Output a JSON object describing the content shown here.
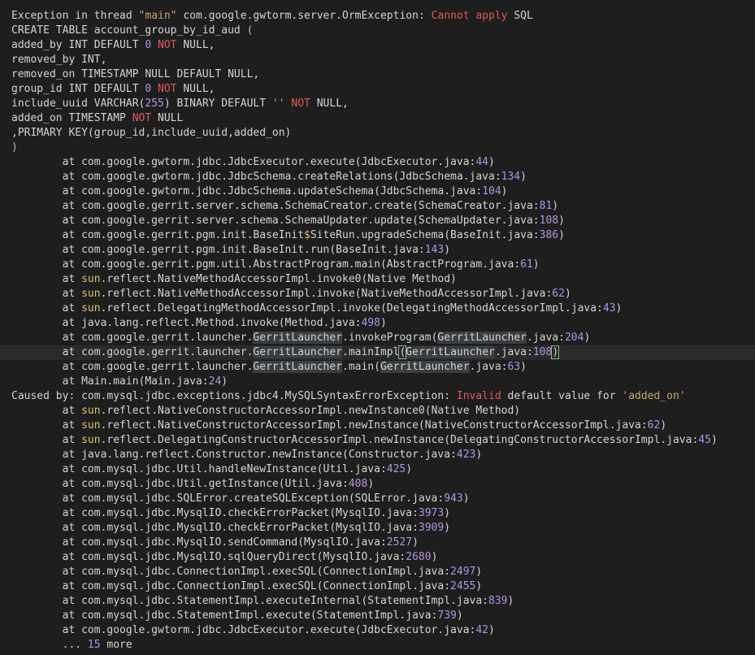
{
  "lines": [
    [
      {
        "t": "Exception in thread ",
        "c": ""
      },
      {
        "t": "\"main\"",
        "c": "str"
      },
      {
        "t": " com.google.gwtorm.server.OrmException",
        "c": ""
      },
      {
        "t": ": ",
        "c": ""
      },
      {
        "t": "Cannot apply",
        "c": "kw"
      },
      {
        "t": " SQL",
        "c": ""
      }
    ],
    [
      {
        "t": "CREATE TABLE account_group_by_id_aud ",
        "c": ""
      },
      {
        "t": "(",
        "c": "paren"
      }
    ],
    [
      {
        "t": "added_by INT DEFAULT ",
        "c": ""
      },
      {
        "t": "0",
        "c": "num"
      },
      {
        "t": " ",
        "c": ""
      },
      {
        "t": "NOT",
        "c": "kw"
      },
      {
        "t": " NULL,",
        "c": ""
      }
    ],
    [
      {
        "t": "removed_by INT,",
        "c": ""
      }
    ],
    [
      {
        "t": "removed_on TIMESTAMP NULL DEFAULT NULL,",
        "c": ""
      }
    ],
    [
      {
        "t": "group_id INT DEFAULT ",
        "c": ""
      },
      {
        "t": "0",
        "c": "num"
      },
      {
        "t": " ",
        "c": ""
      },
      {
        "t": "NOT",
        "c": "kw"
      },
      {
        "t": " NULL,",
        "c": ""
      }
    ],
    [
      {
        "t": "include_uuid VARCHAR(",
        "c": ""
      },
      {
        "t": "255",
        "c": "num"
      },
      {
        "t": ") BINARY DEFAULT ",
        "c": ""
      },
      {
        "t": "''",
        "c": "str"
      },
      {
        "t": " ",
        "c": ""
      },
      {
        "t": "NOT",
        "c": "kw"
      },
      {
        "t": " NULL,",
        "c": ""
      }
    ],
    [
      {
        "t": "added_on TIMESTAMP ",
        "c": ""
      },
      {
        "t": "NOT",
        "c": "kw"
      },
      {
        "t": " NULL",
        "c": ""
      }
    ],
    [
      {
        "t": ",PRIMARY KEY(group_id,include_uuid,added_on)",
        "c": ""
      }
    ],
    [
      {
        "t": ")",
        "c": "paren"
      }
    ],
    [
      {
        "t": "        at com.google.gwtorm.jdbc.JdbcExecutor.execute(JdbcExecutor.java:",
        "c": ""
      },
      {
        "t": "44",
        "c": "num"
      },
      {
        "t": ")",
        "c": ""
      }
    ],
    [
      {
        "t": "        at com.google.gwtorm.jdbc.JdbcSchema.createRelations(JdbcSchema.java:",
        "c": ""
      },
      {
        "t": "134",
        "c": "num"
      },
      {
        "t": ")",
        "c": ""
      }
    ],
    [
      {
        "t": "        at com.google.gwtorm.jdbc.JdbcSchema.updateSchema(JdbcSchema.java:",
        "c": ""
      },
      {
        "t": "104",
        "c": "num"
      },
      {
        "t": ")",
        "c": ""
      }
    ],
    [
      {
        "t": "        at com.google.gerrit.server.schema.SchemaCreator.create(SchemaCreator.java:",
        "c": ""
      },
      {
        "t": "81",
        "c": "num"
      },
      {
        "t": ")",
        "c": ""
      }
    ],
    [
      {
        "t": "        at com.google.gerrit.server.schema.SchemaUpdater.update(SchemaUpdater.java:",
        "c": ""
      },
      {
        "t": "108",
        "c": "num"
      },
      {
        "t": ")",
        "c": ""
      }
    ],
    [
      {
        "t": "        at com.google.gerrit.pgm.init.BaseInit",
        "c": ""
      },
      {
        "t": "$",
        "c": "pkg"
      },
      {
        "t": "SiteRun.upgradeSchema(BaseInit.java:",
        "c": ""
      },
      {
        "t": "386",
        "c": "num"
      },
      {
        "t": ")",
        "c": ""
      }
    ],
    [
      {
        "t": "        at com.google.gerrit.pgm.init.BaseInit.run(BaseInit.java:",
        "c": ""
      },
      {
        "t": "143",
        "c": "num"
      },
      {
        "t": ")",
        "c": ""
      }
    ],
    [
      {
        "t": "        at com.google.gerrit.pgm.util.AbstractProgram.main(AbstractProgram.java:",
        "c": ""
      },
      {
        "t": "61",
        "c": "num"
      },
      {
        "t": ")",
        "c": ""
      }
    ],
    [
      {
        "t": "        at ",
        "c": ""
      },
      {
        "t": "sun",
        "c": "pkg"
      },
      {
        "t": ".reflect.NativeMethodAccessorImpl.invoke0(Native Method)",
        "c": ""
      }
    ],
    [
      {
        "t": "        at ",
        "c": ""
      },
      {
        "t": "sun",
        "c": "pkg"
      },
      {
        "t": ".reflect.NativeMethodAccessorImpl.invoke(NativeMethodAccessorImpl.java:",
        "c": ""
      },
      {
        "t": "62",
        "c": "num"
      },
      {
        "t": ")",
        "c": ""
      }
    ],
    [
      {
        "t": "        at ",
        "c": ""
      },
      {
        "t": "sun",
        "c": "pkg"
      },
      {
        "t": ".reflect.DelegatingMethodAccessorImpl.invoke(DelegatingMethodAccessorImpl.java:",
        "c": ""
      },
      {
        "t": "43",
        "c": "num"
      },
      {
        "t": ")",
        "c": ""
      }
    ],
    [
      {
        "t": "        at java.lang.reflect.Method.invoke(Method.java:",
        "c": ""
      },
      {
        "t": "498",
        "c": "num"
      },
      {
        "t": ")",
        "c": ""
      }
    ],
    [
      {
        "t": "        at com.google.gerrit.launcher.",
        "c": ""
      },
      {
        "t": "GerritLauncher",
        "c": "hl"
      },
      {
        "t": ".invokeProgram(",
        "c": ""
      },
      {
        "t": "GerritLauncher",
        "c": "hl"
      },
      {
        "t": ".java:",
        "c": ""
      },
      {
        "t": "204",
        "c": "num"
      },
      {
        "t": ")",
        "c": ""
      }
    ],
    [
      {
        "t": "        at com.google.gerrit.launcher.",
        "c": ""
      },
      {
        "t": "GerritLauncher",
        "c": "hl"
      },
      {
        "t": ".mainImpl",
        "c": ""
      },
      {
        "t": "(",
        "c": "bracket"
      },
      {
        "t": "GerritLauncher",
        "c": "hl"
      },
      {
        "t": ".java:",
        "c": ""
      },
      {
        "t": "108",
        "c": "num"
      },
      {
        "t": ")",
        "c": "bracket"
      }
    ],
    [
      {
        "t": "        at com.google.gerrit.launcher.",
        "c": ""
      },
      {
        "t": "GerritLauncher",
        "c": "hl"
      },
      {
        "t": ".main(",
        "c": ""
      },
      {
        "t": "GerritLauncher",
        "c": "hl"
      },
      {
        "t": ".java:",
        "c": ""
      },
      {
        "t": "63",
        "c": "num"
      },
      {
        "t": ")",
        "c": ""
      }
    ],
    [
      {
        "t": "        at Main.main(Main.java:",
        "c": ""
      },
      {
        "t": "24",
        "c": "num"
      },
      {
        "t": ")",
        "c": ""
      }
    ],
    [
      {
        "t": "Caused by: com.mysql.jdbc.exceptions.jdbc4.MySQLSyntaxErrorException: ",
        "c": ""
      },
      {
        "t": "Invalid",
        "c": "kw"
      },
      {
        "t": " default value for ",
        "c": ""
      },
      {
        "t": "'added_on'",
        "c": "str"
      }
    ],
    [
      {
        "t": "        at ",
        "c": ""
      },
      {
        "t": "sun",
        "c": "pkg"
      },
      {
        "t": ".reflect.NativeConstructorAccessorImpl.newInstance0(Native Method)",
        "c": ""
      }
    ],
    [
      {
        "t": "        at ",
        "c": ""
      },
      {
        "t": "sun",
        "c": "pkg"
      },
      {
        "t": ".reflect.NativeConstructorAccessorImpl.newInstance(NativeConstructorAccessorImpl.java:",
        "c": ""
      },
      {
        "t": "62",
        "c": "num"
      },
      {
        "t": ")",
        "c": ""
      }
    ],
    [
      {
        "t": "        at ",
        "c": ""
      },
      {
        "t": "sun",
        "c": "pkg"
      },
      {
        "t": ".reflect.DelegatingConstructorAccessorImpl.newInstance(DelegatingConstructorAccessorImpl.java:",
        "c": ""
      },
      {
        "t": "45",
        "c": "num"
      },
      {
        "t": ")",
        "c": ""
      }
    ],
    [
      {
        "t": "        at java.lang.reflect.Constructor.newInstance(Constructor.java:",
        "c": ""
      },
      {
        "t": "423",
        "c": "num"
      },
      {
        "t": ")",
        "c": ""
      }
    ],
    [
      {
        "t": "        at com.mysql.jdbc.Util.handleNewInstance(Util.java:",
        "c": ""
      },
      {
        "t": "425",
        "c": "num"
      },
      {
        "t": ")",
        "c": ""
      }
    ],
    [
      {
        "t": "        at com.mysql.jdbc.Util.getInstance(Util.java:",
        "c": ""
      },
      {
        "t": "408",
        "c": "num"
      },
      {
        "t": ")",
        "c": ""
      }
    ],
    [
      {
        "t": "        at com.mysql.jdbc.SQLError.createSQLException(SQLError.java:",
        "c": ""
      },
      {
        "t": "943",
        "c": "num"
      },
      {
        "t": ")",
        "c": ""
      }
    ],
    [
      {
        "t": "        at com.mysql.jdbc.MysqlIO.checkErrorPacket(MysqlIO.java:",
        "c": ""
      },
      {
        "t": "3973",
        "c": "num"
      },
      {
        "t": ")",
        "c": ""
      }
    ],
    [
      {
        "t": "        at com.mysql.jdbc.MysqlIO.checkErrorPacket(MysqlIO.java:",
        "c": ""
      },
      {
        "t": "3909",
        "c": "num"
      },
      {
        "t": ")",
        "c": ""
      }
    ],
    [
      {
        "t": "        at com.mysql.jdbc.MysqlIO.sendCommand(MysqlIO.java:",
        "c": ""
      },
      {
        "t": "2527",
        "c": "num"
      },
      {
        "t": ")",
        "c": ""
      }
    ],
    [
      {
        "t": "        at com.mysql.jdbc.MysqlIO.sqlQueryDirect(MysqlIO.java:",
        "c": ""
      },
      {
        "t": "2680",
        "c": "num"
      },
      {
        "t": ")",
        "c": ""
      }
    ],
    [
      {
        "t": "        at com.mysql.jdbc.ConnectionImpl.execSQL(ConnectionImpl.java:",
        "c": ""
      },
      {
        "t": "2497",
        "c": "num"
      },
      {
        "t": ")",
        "c": ""
      }
    ],
    [
      {
        "t": "        at com.mysql.jdbc.ConnectionImpl.execSQL(ConnectionImpl.java:",
        "c": ""
      },
      {
        "t": "2455",
        "c": "num"
      },
      {
        "t": ")",
        "c": ""
      }
    ],
    [
      {
        "t": "        at com.mysql.jdbc.StatementImpl.executeInternal(StatementImpl.java:",
        "c": ""
      },
      {
        "t": "839",
        "c": "num"
      },
      {
        "t": ")",
        "c": ""
      }
    ],
    [
      {
        "t": "        at com.mysql.jdbc.StatementImpl.execute(StatementImpl.java:",
        "c": ""
      },
      {
        "t": "739",
        "c": "num"
      },
      {
        "t": ")",
        "c": ""
      }
    ],
    [
      {
        "t": "        at com.google.gwtorm.jdbc.JdbcExecutor.execute(JdbcExecutor.java:",
        "c": ""
      },
      {
        "t": "42",
        "c": "num"
      },
      {
        "t": ")",
        "c": ""
      }
    ],
    [
      {
        "t": "        ... ",
        "c": ""
      },
      {
        "t": "15",
        "c": "num"
      },
      {
        "t": " more",
        "c": ""
      }
    ]
  ],
  "current_line_index": 23
}
